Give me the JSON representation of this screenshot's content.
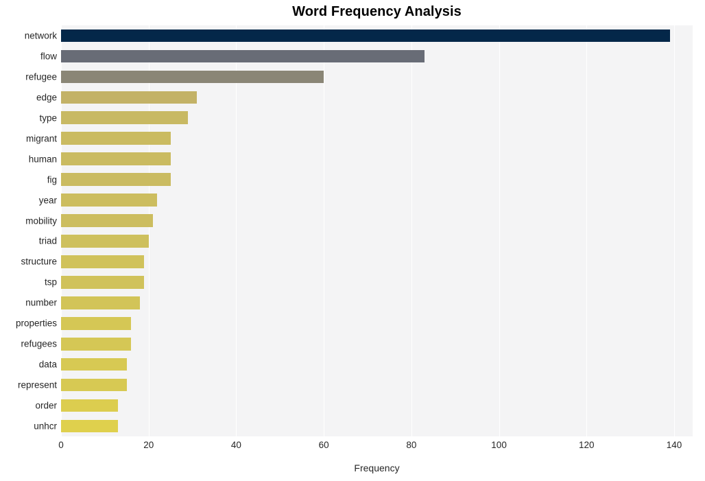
{
  "chart_data": {
    "type": "bar",
    "orientation": "horizontal",
    "title": "Word Frequency Analysis",
    "xlabel": "Frequency",
    "ylabel": "",
    "xlim": [
      0,
      140
    ],
    "xticks": [
      0,
      20,
      40,
      60,
      80,
      100,
      120,
      140
    ],
    "xtick_labels": [
      "0",
      "20",
      "40",
      "60",
      "80",
      "100",
      "120",
      "140"
    ],
    "grid": true,
    "grid_axis": "x",
    "legend": null,
    "categories": [
      "network",
      "flow",
      "refugee",
      "edge",
      "type",
      "migrant",
      "human",
      "fig",
      "year",
      "mobility",
      "triad",
      "structure",
      "tsp",
      "number",
      "properties",
      "refugees",
      "data",
      "represent",
      "order",
      "unhcr"
    ],
    "values": [
      139,
      83,
      60,
      31,
      29,
      25,
      25,
      25,
      22,
      21,
      20,
      19,
      19,
      18,
      16,
      16,
      15,
      15,
      13,
      13
    ],
    "bar_colors": [
      "#042749",
      "#686c76",
      "#8a8676",
      "#c3b267",
      "#c8b963",
      "#cabb61",
      "#cabb61",
      "#cabb61",
      "#ccbd5f",
      "#ccbd5f",
      "#cec05d",
      "#d0c25b",
      "#d0c25b",
      "#d2c458",
      "#d5c755",
      "#d5c755",
      "#d7c953",
      "#d7c953",
      "#dccd4f",
      "#dfd04d"
    ],
    "plot_background": "#f4f4f5",
    "figure_background": "#ffffff",
    "text_color": "#262626",
    "grid_color": "#ffffff"
  }
}
